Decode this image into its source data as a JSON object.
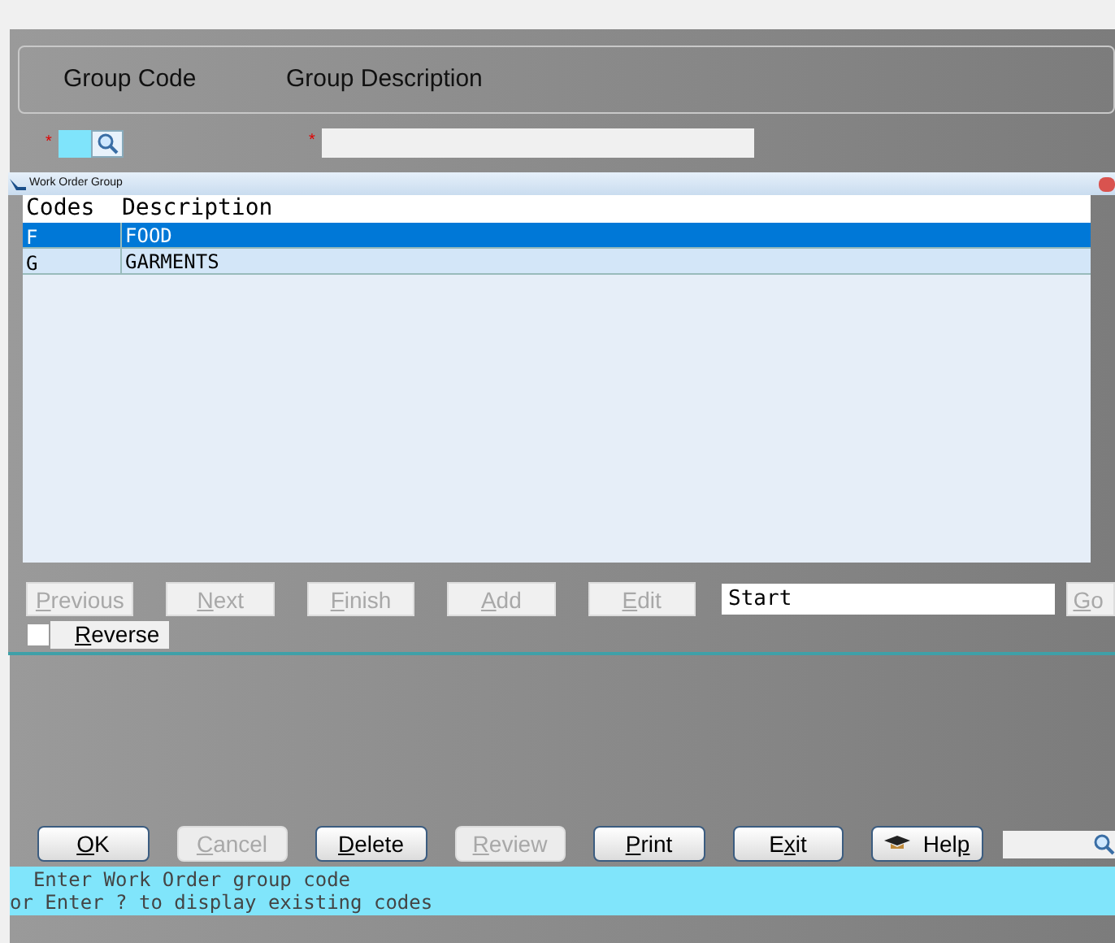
{
  "header": {
    "labels": [
      "Group Code",
      "Group Description"
    ]
  },
  "fields": [
    {
      "kind": "lookup",
      "required_mark": "*"
    },
    {
      "kind": "text",
      "required_mark": "*"
    }
  ],
  "popup": {
    "title": "Work Order Group",
    "table": {
      "columns": [
        "Codes",
        "Description"
      ],
      "rows": [
        {
          "cells": [
            "F",
            "FOOD"
          ],
          "selected": true
        },
        {
          "cells": [
            "G",
            "GARMENTS"
          ],
          "selected": false
        }
      ]
    },
    "nav_buttons": [
      {
        "key": "P",
        "after": "revious",
        "disabled": true
      },
      {
        "key": "N",
        "after": "ext",
        "disabled": true
      },
      {
        "key": "F",
        "after": "inish",
        "disabled": true
      },
      {
        "key": "A",
        "after": "dd",
        "disabled": true
      },
      {
        "key": "E",
        "after": "dit",
        "disabled": true
      }
    ],
    "start_field": {
      "value": "Start"
    },
    "go_button": {
      "key": "G",
      "after": "o",
      "disabled": true
    },
    "reverse": {
      "key": "R",
      "after": "everse",
      "checked": false
    }
  },
  "buttons": [
    {
      "kind": "text",
      "key": "O",
      "after": "K",
      "disabled": false
    },
    {
      "kind": "text",
      "key": "C",
      "after": "ancel",
      "disabled": true
    },
    {
      "kind": "text",
      "key": "D",
      "after": "elete",
      "disabled": false
    },
    {
      "kind": "text",
      "key": "R",
      "after": "eview",
      "disabled": true
    },
    {
      "kind": "text",
      "key": "P",
      "after": "rint",
      "disabled": false
    },
    {
      "kind": "text",
      "before": "E",
      "key": "x",
      "after": "it",
      "disabled": false
    },
    {
      "kind": "help",
      "before": "Hel",
      "key": "p",
      "disabled": false
    }
  ],
  "status_lines": [
    "  Enter Work Order group code",
    "or Enter ? to display existing codes"
  ]
}
